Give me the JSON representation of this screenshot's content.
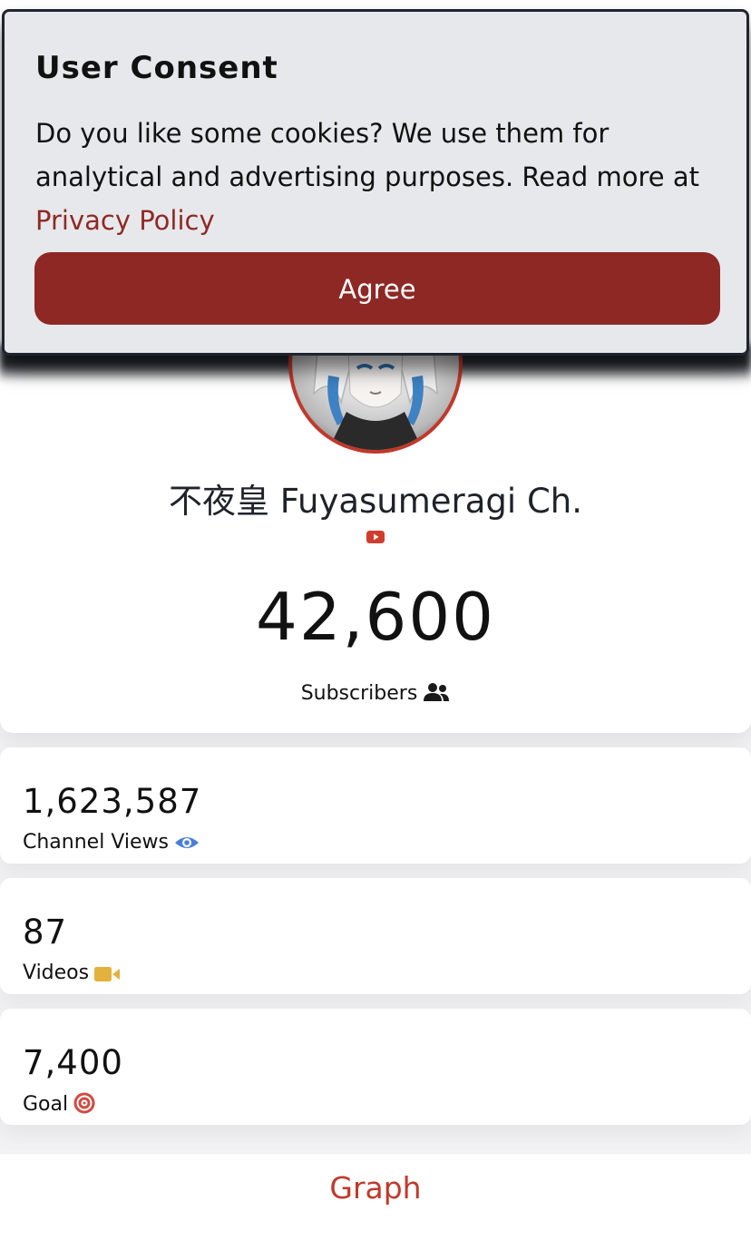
{
  "consent": {
    "title": "User Consent",
    "text": "Do you like some cookies? We use them for analytical and advertising purposes. Read more at",
    "link": "Privacy Policy",
    "button": "Agree"
  },
  "channel": {
    "name": "不夜皇 Fuyasumeragi Ch.",
    "platform_icon": "youtube-icon",
    "subscribers": "42,600",
    "subscribers_label": "Subscribers",
    "subscribers_icon": "users-icon"
  },
  "stats": [
    {
      "value": "1,623,587",
      "label": "Channel Views",
      "icon": "eye-icon",
      "color": "#4a7fd8"
    },
    {
      "value": "87",
      "label": "Videos",
      "icon": "video-camera-icon",
      "color": "#e3b23c"
    },
    {
      "value": "7,400",
      "label": "Goal",
      "icon": "target-icon",
      "color": "#d24a43"
    }
  ],
  "graph": {
    "label": "Graph"
  },
  "colors": {
    "accent": "#c0392b",
    "button": "#8e2825",
    "consent_bg": "#e7e8ec"
  }
}
